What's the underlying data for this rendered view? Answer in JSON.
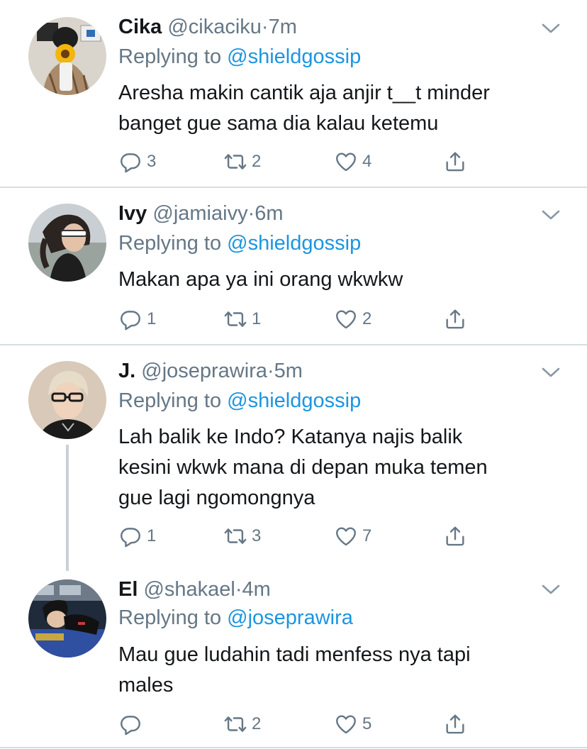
{
  "tweets": [
    {
      "name": "Cika",
      "handle": "@cikaciku",
      "dot": "·",
      "time": "7m",
      "replying_prefix": "Replying to",
      "replying_to": "@shieldgossip",
      "text_lines": [
        "Aresha makin cantik aja anjir t__t minder",
        "banget gue sama dia kalau ketemu"
      ],
      "replies": "3",
      "retweets": "2",
      "likes": "4"
    },
    {
      "name": "Ivy",
      "handle": "@jamiaivy",
      "dot": "·",
      "time": "6m",
      "replying_prefix": "Replying to",
      "replying_to": "@shieldgossip",
      "text_lines": [
        "Makan apa ya ini orang wkwkw"
      ],
      "replies": "1",
      "retweets": "1",
      "likes": "2"
    },
    {
      "name": "J.",
      "handle": "@joseprawira",
      "dot": "·",
      "time": "5m",
      "replying_prefix": "Replying to",
      "replying_to": "@shieldgossip",
      "text_lines": [
        "Lah balik ke Indo? Katanya najis balik",
        "kesini wkwk mana di depan muka temen",
        "gue lagi ngomongnya"
      ],
      "replies": "1",
      "retweets": "3",
      "likes": "7"
    },
    {
      "name": "El",
      "handle": "@shakael",
      "dot": "·",
      "time": "4m",
      "replying_prefix": "Replying to",
      "replying_to": "@joseprawira",
      "text_lines": [
        "Mau gue ludahin tadi menfess nya tapi",
        "males"
      ],
      "replies": "",
      "retweets": "2",
      "likes": "5"
    }
  ],
  "icons": {
    "reply": "reply-icon",
    "retweet": "retweet-icon",
    "like": "heart-icon",
    "share": "share-icon",
    "menu": "chevron-down-icon"
  },
  "colors": {
    "text": "#14171a",
    "secondary": "#657786",
    "mention": "#1b95e0",
    "divider": "#d8dde1"
  }
}
